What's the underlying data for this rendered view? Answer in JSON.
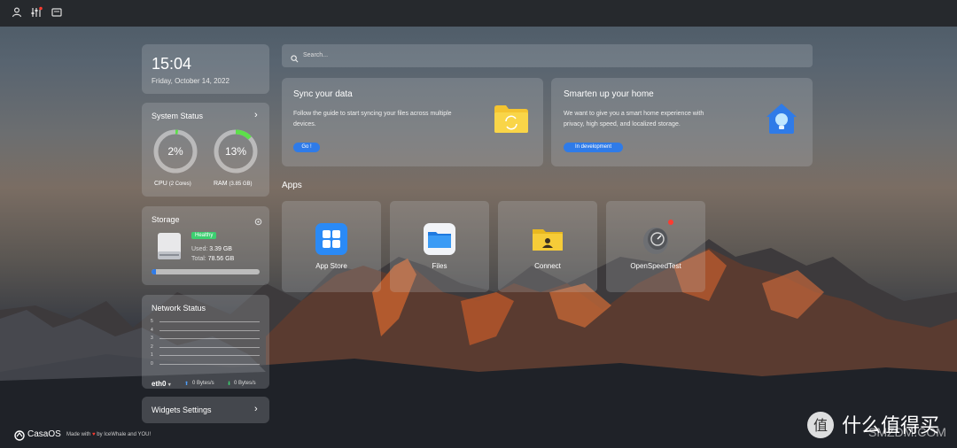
{
  "colors": {
    "accent": "#2f7be8",
    "healthy": "#3ccf70",
    "gauge_fill": "#5de04a",
    "notify_dot": "#ff3b30"
  },
  "topbar": {
    "icons": [
      "user-icon",
      "settings-sliders-icon",
      "screen-icon"
    ]
  },
  "clock": {
    "time": "15:04",
    "date": "Friday, October 14, 2022"
  },
  "system_status": {
    "title": "System Status",
    "cpu": {
      "percent_label": "2%",
      "percent": 2,
      "label": "CPU",
      "detail": "(2 Cores)"
    },
    "ram": {
      "percent_label": "13%",
      "percent": 13,
      "label": "RAM",
      "detail": "(3.85 GB)"
    }
  },
  "storage": {
    "title": "Storage",
    "badge": "Healthy",
    "used_label": "Used:",
    "used_value": "3.39 GB",
    "total_label": "Total:",
    "total_value": "78.56 GB",
    "usage_fraction": 0.043
  },
  "network": {
    "title": "Network Status",
    "y_ticks": [
      "5",
      "4",
      "3",
      "2",
      "1",
      "0"
    ],
    "interface": "eth0",
    "upload": "0 Bytes/s",
    "download": "0 Bytes/s"
  },
  "widgets_settings": {
    "label": "Widgets Settings"
  },
  "footer": {
    "brand": "CasaOS",
    "made_with": "Made with",
    "by": "by IceWhale and YOU!"
  },
  "search": {
    "placeholder": "Search..."
  },
  "sync_card": {
    "title": "Sync your data",
    "text_line1": "Follow the guide to start syncing your files across multiple",
    "text_line2": "devices.",
    "button": "Go !"
  },
  "home_card": {
    "title": "Smarten up your home",
    "text_line1": "We want to give you a smart home experience with",
    "text_line2": "privacy, high speed, and localized storage.",
    "button": "In development"
  },
  "apps": {
    "heading": "Apps",
    "items": [
      {
        "label": "App Store",
        "icon": "app-store-icon"
      },
      {
        "label": "Files",
        "icon": "files-folder-icon"
      },
      {
        "label": "Connect",
        "icon": "connect-folder-icon"
      },
      {
        "label": "OpenSpeedTest",
        "icon": "speedtest-gauge-icon"
      }
    ]
  },
  "watermark": {
    "text": "值 什么值得买",
    "brand": "SMZDM.COM"
  }
}
